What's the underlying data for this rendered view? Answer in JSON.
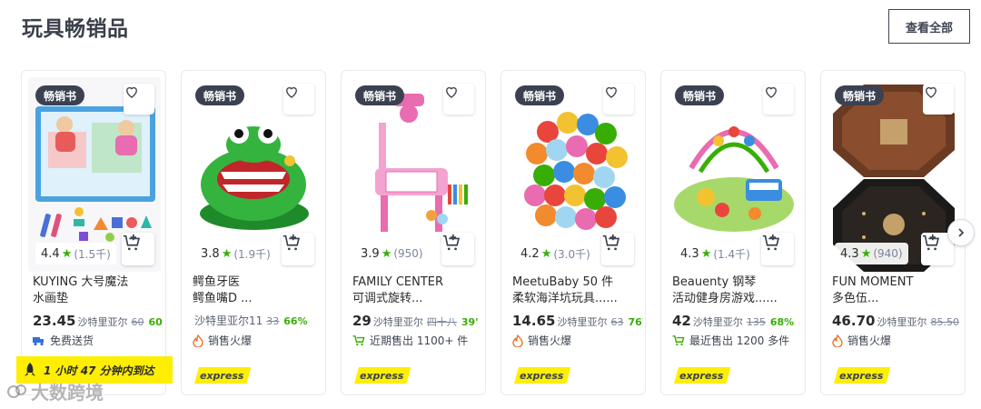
{
  "section": {
    "title": "玩具畅销品",
    "view_all": "查看全部"
  },
  "badge_text": "畅销书",
  "one_hour": "1 小时 47 分钟内到达",
  "watermark": "大数跨境",
  "express_label": "express",
  "colors": {
    "accent_green": "#38ae04",
    "express_yellow": "#feee00",
    "badge_dark": "#3b4151"
  },
  "products": [
    {
      "line1": "KUYING 大号魔法",
      "line2": "水画垫",
      "rating": "4.4",
      "rating_count": "(1.5千)",
      "price": "23.45",
      "currency": "沙特里亚尔",
      "old_price": "60",
      "discount": "60",
      "tag": "免费送货",
      "tag_icon": "truck-icon"
    },
    {
      "line1": "鳄鱼牙医",
      "line2": "鳄鱼嘴D ...",
      "rating": "3.8",
      "rating_count": "(1.9千)",
      "price": "",
      "currency": "沙特里亚尔11",
      "old_price": "33",
      "discount": "66%",
      "tag": "销售火爆",
      "tag_icon": "fire-icon"
    },
    {
      "line1": "FAMILY CENTER",
      "line2": "可调式旋转...",
      "rating": "3.9",
      "rating_count": "(950)",
      "price": "29",
      "currency": "沙特里亚尔",
      "old_price": "四十八",
      "discount": "39'",
      "tag": "近期售出 1100+ 件",
      "tag_icon": "cart-sold-icon"
    },
    {
      "line1": "MeetuBaby 50 件",
      "line2": "柔软海洋坑玩具......",
      "rating": "4.2",
      "rating_count": "(3.0千)",
      "price": "14.65",
      "currency": "沙特里亚尔",
      "old_price": "63",
      "discount": "76'",
      "tag": "销售火爆",
      "tag_icon": "fire-icon"
    },
    {
      "line1": "Beauenty 钢琴",
      "line2": "活动健身房游戏......",
      "rating": "4.3",
      "rating_count": "(1.4千)",
      "price": "42",
      "currency": "沙特里亚尔",
      "old_price": "135",
      "discount": "68%",
      "tag": "最近售出 1200 多件",
      "tag_icon": "cart-sold-icon"
    },
    {
      "line1": "FUN MOMENT",
      "line2": "多色伍...",
      "rating": "4.3",
      "rating_count": "(940)",
      "price": "46.70",
      "currency": "沙特里亚尔",
      "old_price": "85.50",
      "discount": "",
      "tag": "销售火爆",
      "tag_icon": "fire-icon"
    }
  ]
}
